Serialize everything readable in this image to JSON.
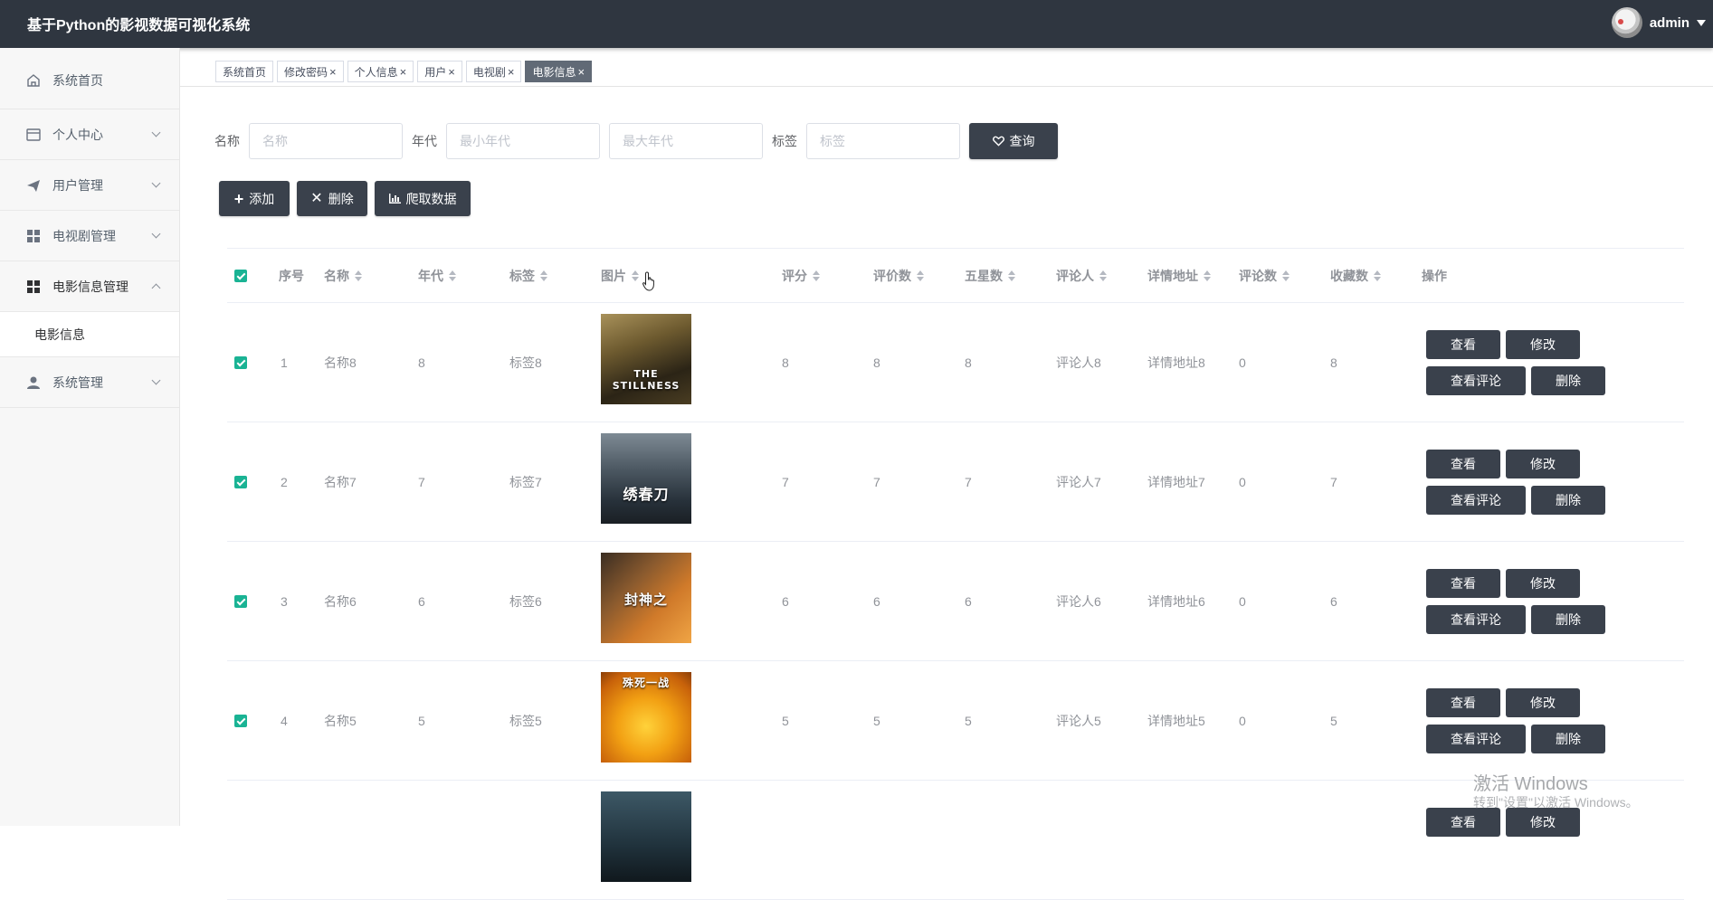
{
  "header": {
    "title": "基于Python的影视数据可视化系统",
    "user": "admin"
  },
  "sidebar": {
    "items": [
      {
        "label": "系统首页",
        "icon": "home-icon"
      },
      {
        "label": "个人中心",
        "icon": "id-card-icon"
      },
      {
        "label": "用户管理",
        "icon": "paper-plane-icon"
      },
      {
        "label": "电视剧管理",
        "icon": "grid-icon"
      },
      {
        "label": "电影信息管理",
        "icon": "grid-icon"
      },
      {
        "label": "系统管理",
        "icon": "user-icon"
      }
    ],
    "sub_item": "电影信息"
  },
  "tabs": [
    "系统首页",
    "修改密码",
    "个人信息",
    "用户",
    "电视剧",
    "电影信息"
  ],
  "search": {
    "name_label": "名称",
    "name_placeholder": "名称",
    "year_label": "年代",
    "year_min_placeholder": "最小年代",
    "year_max_placeholder": "最大年代",
    "tag_label": "标签",
    "tag_placeholder": "标签",
    "query_label": "查询"
  },
  "actions": {
    "add": "添加",
    "delete": "删除",
    "crawl": "爬取数据"
  },
  "table": {
    "headers": [
      "序号",
      "名称",
      "年代",
      "标签",
      "图片",
      "评分",
      "评价数",
      "五星数",
      "评论人",
      "详情地址",
      "评论数",
      "收藏数",
      "操作"
    ],
    "rows": [
      {
        "no": "1",
        "name": "名称8",
        "year": "8",
        "tag": "标签8",
        "poster_text": "THE STILLNESS",
        "rating": "8",
        "reviews": "8",
        "five_star": "8",
        "reviewer": "评论人8",
        "detail": "详情地址8",
        "comments": "0",
        "favorites": "8"
      },
      {
        "no": "2",
        "name": "名称7",
        "year": "7",
        "tag": "标签7",
        "poster_text": "绣春刀",
        "rating": "7",
        "reviews": "7",
        "five_star": "7",
        "reviewer": "评论人7",
        "detail": "详情地址7",
        "comments": "0",
        "favorites": "7"
      },
      {
        "no": "3",
        "name": "名称6",
        "year": "6",
        "tag": "标签6",
        "poster_text": "封神之",
        "rating": "6",
        "reviews": "6",
        "five_star": "6",
        "reviewer": "评论人6",
        "detail": "详情地址6",
        "comments": "0",
        "favorites": "6"
      },
      {
        "no": "4",
        "name": "名称5",
        "year": "5",
        "tag": "标签5",
        "poster_text": "殊死一战",
        "rating": "5",
        "reviews": "5",
        "five_star": "5",
        "reviewer": "评论人5",
        "detail": "详情地址5",
        "comments": "0",
        "favorites": "5"
      }
    ],
    "row_buttons": {
      "view": "查看",
      "edit": "修改",
      "view_comments": "查看评论",
      "delete": "删除"
    }
  },
  "watermark": {
    "line1": "激活 Windows",
    "line2": "转到\"设置\"以激活 Windows。"
  }
}
